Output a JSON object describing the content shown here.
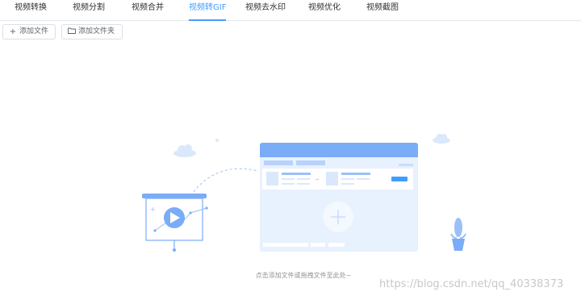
{
  "tabs": [
    {
      "label": "视频转换",
      "active": false
    },
    {
      "label": "视频分割",
      "active": false
    },
    {
      "label": "视频合并",
      "active": false
    },
    {
      "label": "视频转GIF",
      "active": true
    },
    {
      "label": "视频去水印",
      "active": false
    },
    {
      "label": "视频优化",
      "active": false
    },
    {
      "label": "视频截图",
      "active": false
    }
  ],
  "toolbar": {
    "add_file_label": "添加文件",
    "add_folder_label": "添加文件夹",
    "add_file_icon": "plus-icon",
    "add_folder_icon": "folder-icon"
  },
  "dropzone": {
    "hint": "点击添加文件或拖拽文件至此处~"
  },
  "watermark": "https://blog.csdn.net/qq_40338373",
  "colors": {
    "accent": "#409eff",
    "illustration_primary": "#7aacf8",
    "illustration_light": "#e8f1fe",
    "text": "#303133",
    "muted": "#909399"
  }
}
